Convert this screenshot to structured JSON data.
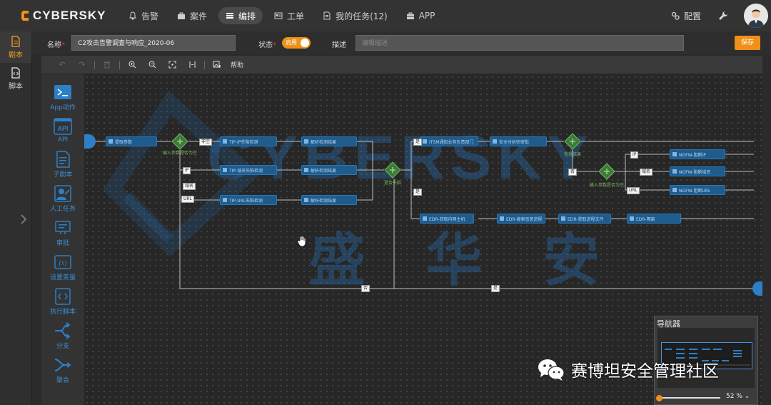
{
  "brand": {
    "name": "CYBERSKY",
    "accent": "#F09018",
    "primary_blue": "#2B77B6"
  },
  "nav": {
    "items": [
      {
        "label": "告警",
        "icon": "bell-icon"
      },
      {
        "label": "案件",
        "icon": "briefcase-icon"
      },
      {
        "label": "编排",
        "icon": "list-icon",
        "active": true
      },
      {
        "label": "工单",
        "icon": "id-card-icon"
      },
      {
        "label": "我的任务(12)",
        "icon": "document-icon"
      },
      {
        "label": "APP",
        "icon": "toolbox-icon"
      }
    ],
    "config_label": "配置"
  },
  "sidebar": {
    "items": [
      {
        "label": "剧本",
        "icon": "file-icon",
        "active": true
      },
      {
        "label": "脚本",
        "icon": "code-file-icon"
      }
    ]
  },
  "form": {
    "name_label": "名称",
    "name_value": "C2攻击告警调查与响应_2020-06",
    "status_label": "状态",
    "status_toggle": "启用",
    "desc_label": "描述",
    "desc_placeholder": "编辑描述",
    "save_label": "保存"
  },
  "toolbar": {
    "help_label": "帮助"
  },
  "palette": {
    "items": [
      {
        "label": "App动作",
        "icon": "terminal-icon"
      },
      {
        "label": "API",
        "icon": "api-icon"
      },
      {
        "label": "子剧本",
        "icon": "subplaybook-icon"
      },
      {
        "label": "人工任务",
        "icon": "person-task-icon"
      },
      {
        "label": "审批",
        "icon": "approval-icon"
      },
      {
        "label": "设置变量",
        "icon": "variable-icon"
      },
      {
        "label": "执行脚本",
        "icon": "script-icon"
      },
      {
        "label": "分支",
        "icon": "branch-icon"
      },
      {
        "label": "聚合",
        "icon": "merge-icon"
      }
    ]
  },
  "watermark": {
    "brand": "CYBERSKY",
    "chars": [
      "盛",
      "华",
      "安"
    ]
  },
  "flow": {
    "nodes": [
      {
        "id": "n1",
        "label": "提取参数"
      },
      {
        "id": "n2",
        "label": "TIP-IP失陷检测"
      },
      {
        "id": "n3",
        "label": "TIP-域名失陷检测"
      },
      {
        "id": "n4",
        "label": "TIP-URL失陷检测"
      },
      {
        "id": "n5",
        "label": "解析检测结果"
      },
      {
        "id": "n6",
        "label": "解析检测结果"
      },
      {
        "id": "n7",
        "label": "解析检测结果"
      },
      {
        "id": "n8",
        "label": "ITSM通知业务负责部门"
      },
      {
        "id": "n9",
        "label": "安全分析师审批"
      },
      {
        "id": "n10",
        "label": "NGFW-阻断IP"
      },
      {
        "id": "n11",
        "label": "NGFW-阻断域名"
      },
      {
        "id": "n12",
        "label": "NGFW-阻断URL"
      },
      {
        "id": "n13",
        "label": "EDR-获取内网主机"
      },
      {
        "id": "n14",
        "label": "EDR-搜索恶意进程"
      },
      {
        "id": "n15",
        "label": "EDR-获取进程文件"
      },
      {
        "id": "n16",
        "label": "EDR-隔离"
      }
    ],
    "gateways": [
      {
        "id": "g1",
        "label": "输入参数是否为空"
      },
      {
        "id": "g2",
        "label": "是否失陷"
      },
      {
        "id": "g3",
        "label": "审批结果"
      },
      {
        "id": "g4",
        "label": "输入参数是否为空"
      }
    ],
    "edge_labels": [
      "非空",
      "IP",
      "域名",
      "URL",
      "是",
      "是",
      "否",
      "IP",
      "域名",
      "URL",
      "否",
      "是"
    ]
  },
  "navigator": {
    "title": "导航器",
    "zoom": "52 %"
  },
  "overlay": {
    "wechat_text": "赛博坦安全管理社区"
  }
}
